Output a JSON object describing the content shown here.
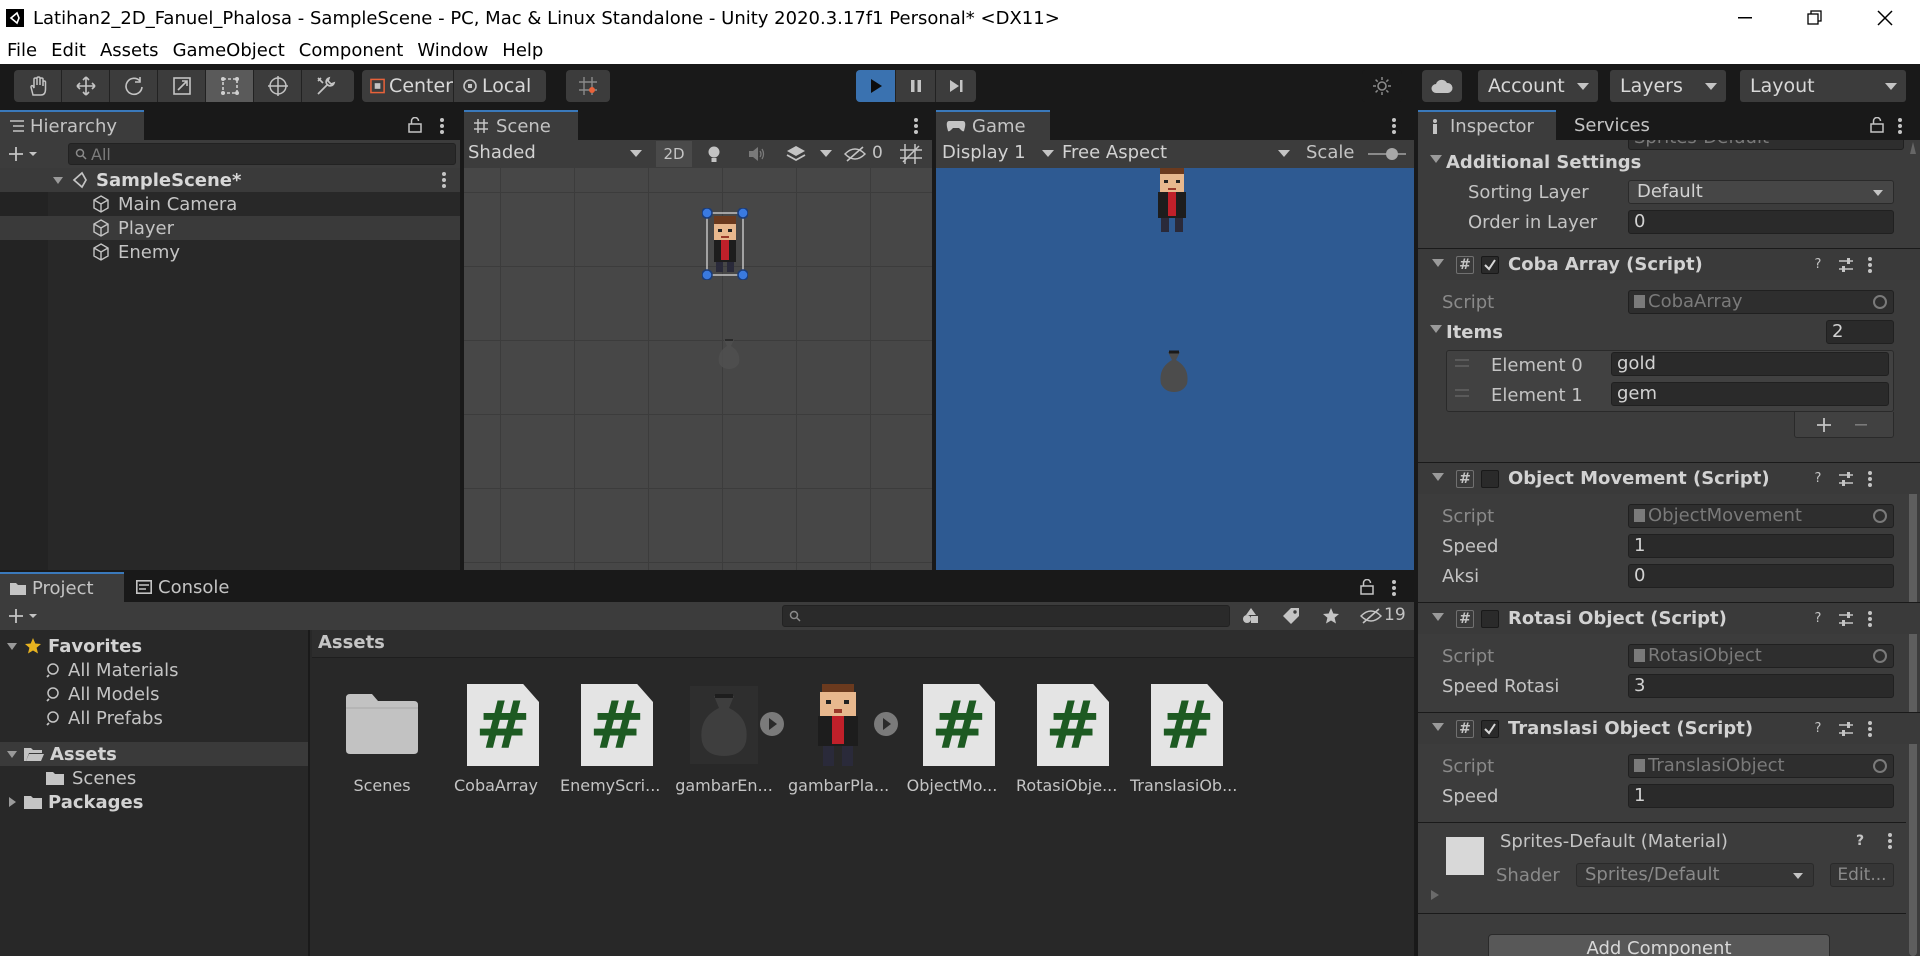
{
  "window": {
    "title": "Latihan2_2D_Fanuel_Phalosa - SampleScene - PC, Mac & Linux Standalone - Unity 2020.3.17f1 Personal* <DX11>"
  },
  "menu": [
    "File",
    "Edit",
    "Assets",
    "GameObject",
    "Component",
    "Window",
    "Help"
  ],
  "toolbar": {
    "pivot_label": "Center",
    "space_label": "Local",
    "account_label": "Account",
    "layers_label": "Layers",
    "layout_label": "Layout"
  },
  "hierarchy": {
    "tab": "Hierarchy",
    "search_placeholder": "All",
    "scene": "SampleScene*",
    "objects": [
      "Main Camera",
      "Player",
      "Enemy"
    ]
  },
  "scene_view": {
    "tab": "Scene",
    "shading": "Shaded",
    "mode_2d": "2D",
    "hidden_count": "0"
  },
  "game_view": {
    "tab": "Game",
    "display": "Display 1",
    "aspect": "Free Aspect",
    "scale_label": "Scale",
    "background": "#2e5a92"
  },
  "project": {
    "tab": "Project",
    "console_tab": "Console",
    "hidden_count": "19",
    "favorites_label": "Favorites",
    "favorites": [
      "All Materials",
      "All Models",
      "All Prefabs"
    ],
    "assets_label": "Assets",
    "assets_children": [
      "Scenes"
    ],
    "packages_label": "Packages",
    "breadcrumb": "Assets",
    "items": [
      {
        "label": "Scenes",
        "icon": "folder"
      },
      {
        "label": "CobaArray",
        "icon": "script"
      },
      {
        "label": "EnemyScri...",
        "icon": "script"
      },
      {
        "label": "gambarEn...",
        "icon": "sprite-bag"
      },
      {
        "label": "gambarPla...",
        "icon": "sprite-player"
      },
      {
        "label": "ObjectMo...",
        "icon": "script"
      },
      {
        "label": "RotasiObje...",
        "icon": "script"
      },
      {
        "label": "TranslasiOb...",
        "icon": "script"
      }
    ]
  },
  "inspector": {
    "tab": "Inspector",
    "services_tab": "Services",
    "top_partial": "Sprites-Default",
    "additional_settings": "Additional Settings",
    "sorting_layer_label": "Sorting Layer",
    "sorting_layer_value": "Default",
    "order_label": "Order in Layer",
    "order_value": "0",
    "script_label": "Script",
    "coba": {
      "title": "Coba Array (Script)",
      "enabled": true,
      "script": "CobaArray",
      "items_label": "Items",
      "items_count": "2",
      "elements": [
        {
          "label": "Element 0",
          "value": "gold"
        },
        {
          "label": "Element 1",
          "value": "gem"
        }
      ]
    },
    "movement": {
      "title": "Object Movement (Script)",
      "enabled": false,
      "script": "ObjectMovement",
      "speed_label": "Speed",
      "speed": "1",
      "aksi_label": "Aksi",
      "aksi": "0"
    },
    "rotasi": {
      "title": "Rotasi Object (Script)",
      "enabled": false,
      "script": "RotasiObject",
      "speed_label": "Speed Rotasi",
      "speed": "3"
    },
    "translasi": {
      "title": "Translasi Object (Script)",
      "enabled": true,
      "script": "TranslasiObject",
      "speed_label": "Speed",
      "speed": "1"
    },
    "material": {
      "title": "Sprites-Default (Material)",
      "shader_label": "Shader",
      "shader": "Sprites/Default",
      "edit_label": "Edit..."
    },
    "add_component": "Add Component"
  }
}
